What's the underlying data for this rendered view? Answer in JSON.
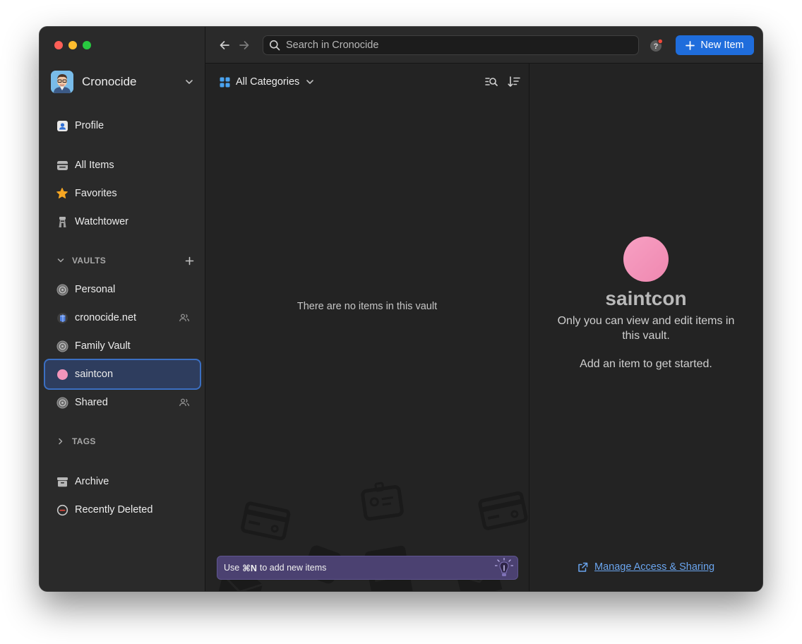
{
  "account": {
    "name": "Cronocide"
  },
  "sidebar": {
    "profile": "Profile",
    "all_items": "All Items",
    "favorites": "Favorites",
    "watchtower": "Watchtower",
    "vaults_header": "VAULTS",
    "vaults": [
      {
        "label": "Personal",
        "shared": false
      },
      {
        "label": "cronocide.net",
        "shared": true
      },
      {
        "label": "Family Vault",
        "shared": false
      },
      {
        "label": "saintcon",
        "shared": false,
        "selected": true
      },
      {
        "label": "Shared",
        "shared": true
      }
    ],
    "tags_header": "TAGS",
    "archive": "Archive",
    "recently_deleted": "Recently Deleted"
  },
  "toolbar": {
    "search_placeholder": "Search in Cronocide",
    "new_item_label": "New Item"
  },
  "list": {
    "category_filter": "All Categories",
    "empty_message": "There are no items in this vault",
    "hint_prefix": "Use",
    "hint_shortcut": "⌘N",
    "hint_suffix": "to add new items"
  },
  "detail": {
    "vault_name": "saintcon",
    "description": "Only you can view and edit items in this vault.",
    "add_prompt": "Add an item to get started.",
    "manage_link": "Manage Access & Sharing",
    "vault_color": "#f395bb"
  },
  "colors": {
    "accent": "#1f6ddc",
    "selection_border": "#3b6fc2",
    "hint_background": "#4b4171",
    "link": "#6aa5ef"
  }
}
